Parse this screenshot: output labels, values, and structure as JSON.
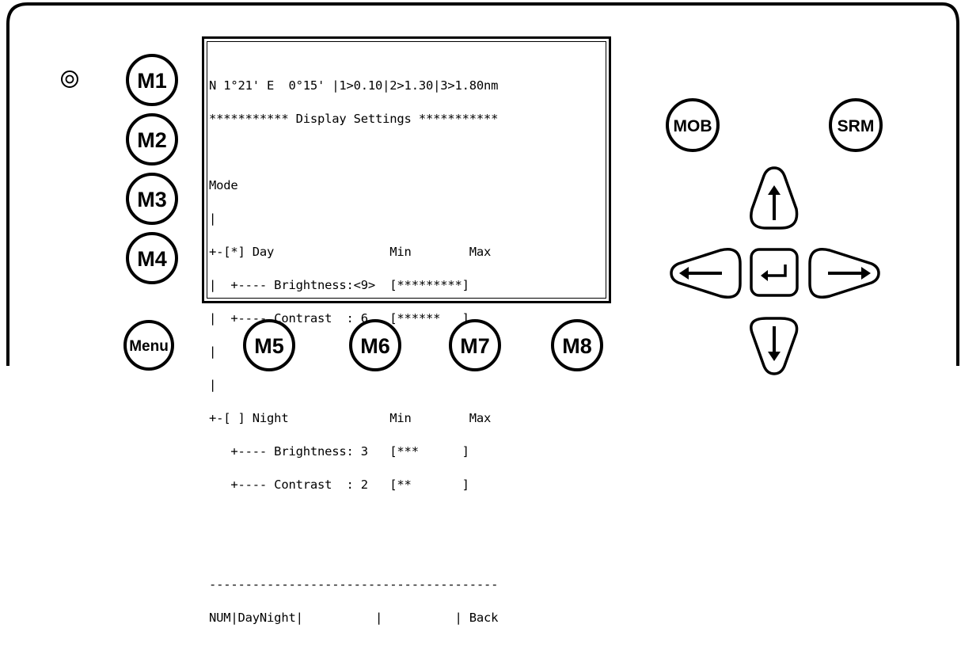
{
  "panel": {
    "buttons": {
      "m1": "M1",
      "m2": "M2",
      "m3": "M3",
      "m4": "M4",
      "m5": "M5",
      "m6": "M6",
      "m7": "M7",
      "m8": "M8",
      "menu": "Menu",
      "mob": "MOB",
      "srm": "SRM"
    },
    "arrows": {
      "up": "up-arrow-icon",
      "down": "down-arrow-icon",
      "left": "left-arrow-icon",
      "right": "right-arrow-icon",
      "enter": "enter-icon"
    }
  },
  "screen": {
    "lines": [
      "N 1°21' E  0°15' |1>0.10|2>1.30|3>1.80nm",
      "*********** Display Settings ***********",
      "",
      "Mode",
      "|",
      "+-[*] Day                Min        Max",
      "|  +---- Brightness:<9>  [*********]",
      "|  +---- Contrast  : 6   [******   ]",
      "|",
      "|",
      "+-[ ] Night              Min        Max",
      "   +---- Brightness: 3   [***      ]",
      "   +---- Contrast  : 2   [**       ]",
      "",
      "",
      "----------------------------------------",
      "NUM|DayNight|          |          | Back"
    ]
  }
}
